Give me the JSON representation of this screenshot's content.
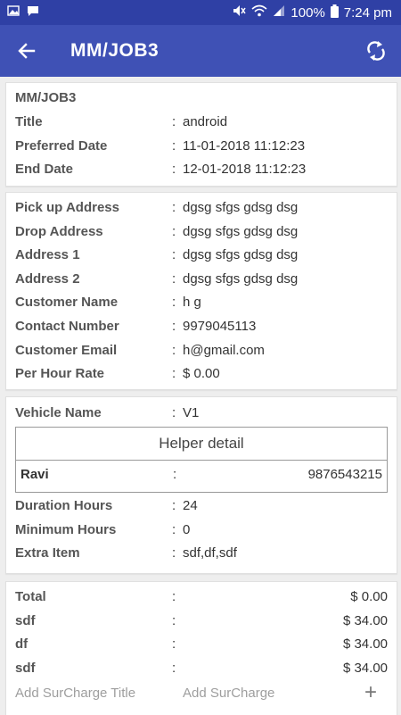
{
  "status_bar": {
    "battery": "100%",
    "time": "7:24 pm"
  },
  "app_bar": {
    "title": "MM/JOB3"
  },
  "job": {
    "header": "MM/JOB3",
    "rows": [
      {
        "label": "Title",
        "value": "android"
      },
      {
        "label": "Preferred Date",
        "value": "11-01-2018 11:12:23"
      },
      {
        "label": "End Date",
        "value": "12-01-2018 11:12:23"
      }
    ]
  },
  "address": {
    "rows": [
      {
        "label": "Pick up Address",
        "value": "dgsg sfgs gdsg dsg"
      },
      {
        "label": "Drop Address",
        "value": "dgsg sfgs gdsg dsg"
      },
      {
        "label": "Address 1",
        "value": "dgsg sfgs gdsg dsg"
      },
      {
        "label": "Address 2",
        "value": "dgsg sfgs gdsg dsg"
      },
      {
        "label": "Customer Name",
        "value": "h g"
      },
      {
        "label": "Contact Number",
        "value": "9979045113"
      },
      {
        "label": "Customer Email",
        "value": "h@gmail.com"
      },
      {
        "label": "Per Hour Rate",
        "value": "$ 0.00"
      }
    ]
  },
  "vehicle": {
    "vehicle_name": {
      "label": "Vehicle Name",
      "value": "V1"
    },
    "helper_title": "Helper detail",
    "helper": {
      "name": "Ravi",
      "phone": "9876543215"
    },
    "rows": [
      {
        "label": "Duration Hours",
        "value": "24"
      },
      {
        "label": "Minimum Hours",
        "value": "0"
      },
      {
        "label": "Extra Item",
        "value": "sdf,df,sdf"
      }
    ]
  },
  "charges": {
    "rows": [
      {
        "label": "Total",
        "value": "$ 0.00"
      },
      {
        "label": "sdf",
        "value": "$ 34.00"
      },
      {
        "label": "df",
        "value": "$ 34.00"
      },
      {
        "label": "sdf",
        "value": "$ 34.00"
      }
    ],
    "add_title_placeholder": "Add SurCharge Title",
    "add_amount_placeholder": "Add SurCharge",
    "add_symbol": "+"
  },
  "colors": {
    "status_bar": "#2f40a5",
    "app_bar": "#3f51b5"
  }
}
